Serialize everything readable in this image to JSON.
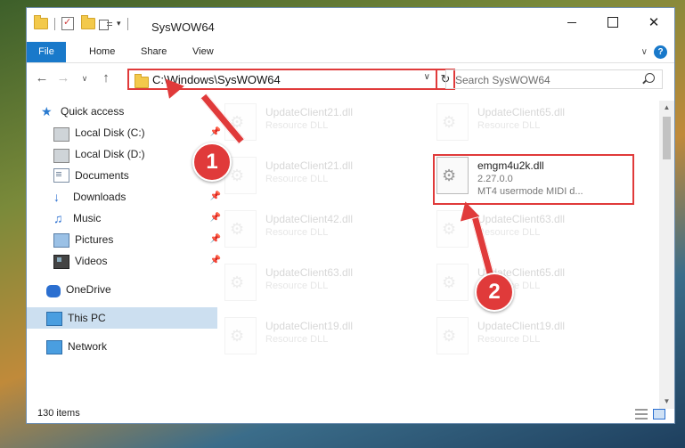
{
  "window": {
    "title": "SysWOW64",
    "controls": {
      "minimize": "",
      "maximize": "",
      "close": "✕"
    }
  },
  "ribbon": {
    "tabs": [
      "File",
      "Home",
      "Share",
      "View"
    ],
    "help": "?"
  },
  "address_bar": {
    "path": "C:\\Windows\\SysWOW64",
    "refresh_icon": "↻"
  },
  "search": {
    "placeholder": "Search SysWOW64"
  },
  "sidebar": {
    "items": [
      {
        "label": "Quick access",
        "icon": "star-icon",
        "pinned": false
      },
      {
        "label": "Local Disk (C:)",
        "icon": "disk-icon",
        "pinned": true
      },
      {
        "label": "Local Disk (D:)",
        "icon": "disk-icon",
        "pinned": true
      },
      {
        "label": "Documents",
        "icon": "documents-icon",
        "pinned": true
      },
      {
        "label": "Downloads",
        "icon": "downloads-icon",
        "pinned": true
      },
      {
        "label": "Music",
        "icon": "music-icon",
        "pinned": true
      },
      {
        "label": "Pictures",
        "icon": "pictures-icon",
        "pinned": true
      },
      {
        "label": "Videos",
        "icon": "videos-icon",
        "pinned": true
      },
      {
        "label": "OneDrive",
        "icon": "onedrive-icon",
        "pinned": false
      },
      {
        "label": "This PC",
        "icon": "this-pc-icon",
        "pinned": false,
        "selected": true
      },
      {
        "label": "Network",
        "icon": "network-icon",
        "pinned": false
      }
    ]
  },
  "files": [
    {
      "name": "UpdateClient21.dll",
      "type": "Resource DLL"
    },
    {
      "name": "UpdateClient65.dll",
      "type": "Resource DLL"
    },
    {
      "name": "UpdateClient21.dll",
      "type": "Resource DLL"
    },
    {
      "name": "emgm4u2k.dll",
      "version": "2.27.0.0",
      "description": "MT4 usermode MIDI d...",
      "highlighted": true
    },
    {
      "name": "UpdateClient42.dll",
      "type": "Resource DLL"
    },
    {
      "name": "UpdateClient63.dll",
      "type": "Resource DLL"
    },
    {
      "name": "UpdateClient63.dll",
      "type": "Resource DLL"
    },
    {
      "name": "UpdateClient65.dll",
      "type": "Resource DLL"
    },
    {
      "name": "UpdateClient19.dll",
      "type": "Resource DLL"
    },
    {
      "name": "UpdateClient19.dll",
      "type": "Resource DLL"
    }
  ],
  "status_bar": {
    "item_count": "130 items"
  },
  "annotations": {
    "step1": "1",
    "step2": "2"
  },
  "colors": {
    "accent": "#1979ca",
    "annotation": "#e03a3a",
    "selection": "#ccdff0"
  }
}
